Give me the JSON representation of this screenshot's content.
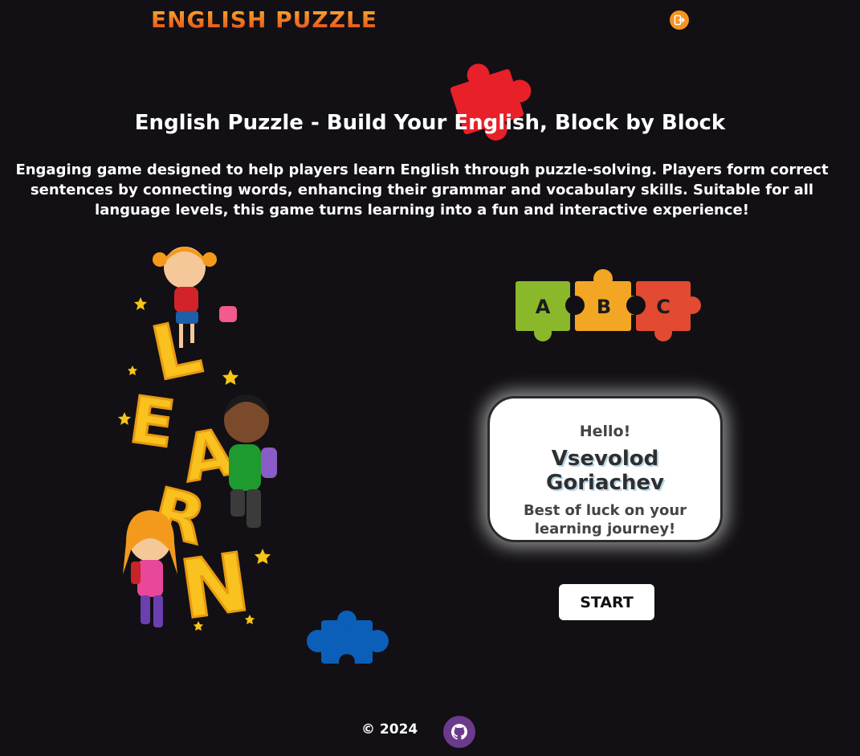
{
  "header": {
    "logo_text": "ENGLISH PUZZLE",
    "logout_icon": "logout-icon"
  },
  "main": {
    "title": "English Puzzle - Build Your English, Block by Block",
    "description": "Engaging game designed to help players learn English through puzzle-solving. Players form correct sentences by connecting words, enhancing their grammar and vocabulary skills. Suitable for all language levels, this game turns learning into a fun and interactive experience!",
    "illustration_word": "LEARN",
    "puzzle_letters": [
      "A",
      "B",
      "C"
    ]
  },
  "greeting": {
    "hello": "Hello!",
    "user_name": "Vsevolod Goriachev",
    "wish": "Best of luck on your learning journey!"
  },
  "actions": {
    "start_label": "START"
  },
  "footer": {
    "copyright": "©  2024",
    "github_icon": "github-icon"
  },
  "colors": {
    "background": "#121014",
    "accent_orange": "#f7931e",
    "piece_red": "#e8202a",
    "piece_blue": "#0b5fb8",
    "piece_green": "#8ab82a",
    "piece_yellow": "#f2a623",
    "piece_coral": "#e24a32"
  }
}
